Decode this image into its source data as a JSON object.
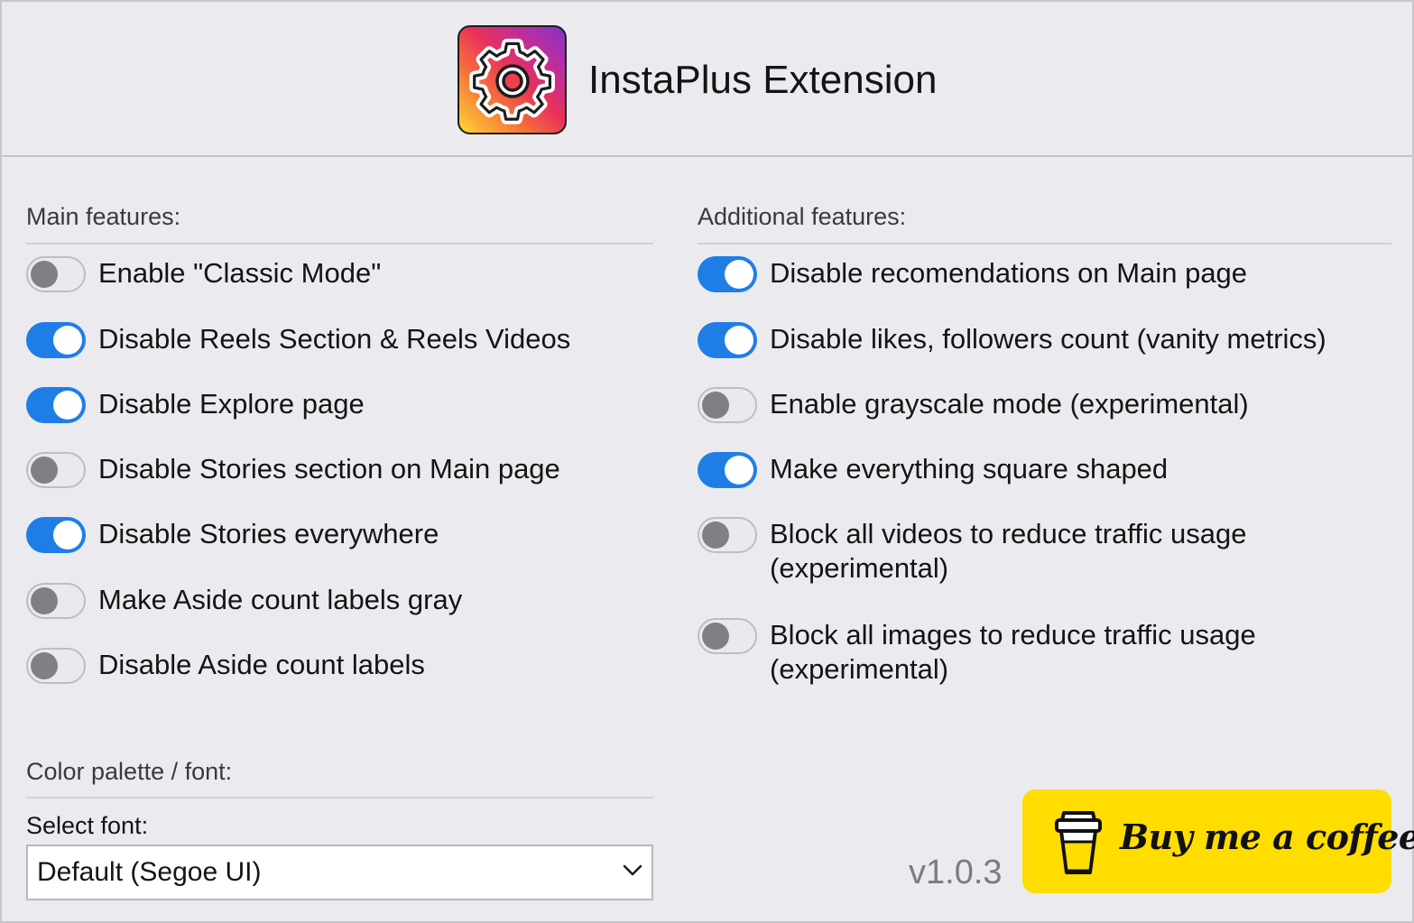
{
  "header": {
    "title": "InstaPlus Extension",
    "logo_icon": "gear-icon",
    "logo_colors": [
      "#fdd835",
      "#f77737",
      "#e8315a",
      "#b82ea3",
      "#8034c9"
    ]
  },
  "main_features": {
    "heading": "Main features:",
    "options": [
      {
        "label": "Enable \"Classic Mode\"",
        "enabled": false
      },
      {
        "label": "Disable Reels Section & Reels Videos",
        "enabled": true
      },
      {
        "label": "Disable Explore page",
        "enabled": true
      },
      {
        "label": "Disable Stories section on Main page",
        "enabled": false
      },
      {
        "label": "Disable Stories everywhere",
        "enabled": true
      },
      {
        "label": "Make Aside count labels gray",
        "enabled": false
      },
      {
        "label": "Disable Aside count labels",
        "enabled": false
      }
    ]
  },
  "additional_features": {
    "heading": "Additional features:",
    "options": [
      {
        "label": "Disable recomendations on Main page",
        "enabled": true
      },
      {
        "label": "Disable likes, followers count (vanity metrics)",
        "enabled": true
      },
      {
        "label": "Enable grayscale mode (experimental)",
        "enabled": false
      },
      {
        "label": "Make everything square shaped",
        "enabled": true
      },
      {
        "label": "Block all videos to reduce traffic usage",
        "label_line2": "(experimental)",
        "enabled": false
      },
      {
        "label": "Block all images to reduce traffic usage",
        "label_line2": "(experimental)",
        "enabled": false
      }
    ]
  },
  "palette": {
    "heading": "Color palette / font:",
    "font_label": "Select font:",
    "font_value": "Default (Segoe UI)"
  },
  "footer": {
    "version": "v1.0.3",
    "coffee_label": "Buy me a coffee",
    "coffee_icon": "coffee-cup-icon"
  },
  "colors": {
    "toggle_on": "#1f7ee6",
    "toggle_off": "#eaeaee",
    "coffee_button": "#ffdd00",
    "background": "#ebebef"
  }
}
